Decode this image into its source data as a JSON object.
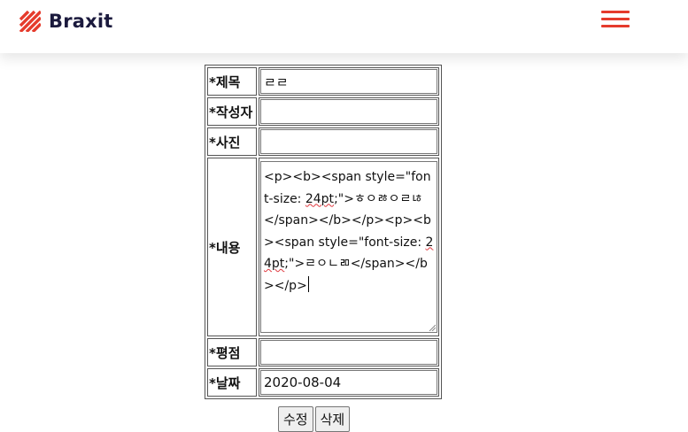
{
  "header": {
    "brand": "Braxit",
    "accent_color": "#e53b2c",
    "brand_color": "#1b1a3d",
    "icon": "hamburger-menu-icon"
  },
  "form": {
    "labels": {
      "title": "*제목",
      "author": "*작성자",
      "photo": "*사진",
      "content": "*내용",
      "rating": "*평점",
      "date": "*날짜"
    },
    "values": {
      "title": "ㄹㄹ",
      "author": "",
      "photo": "",
      "content": {
        "seg1": "<p><b><span style=\"font-size: ",
        "seg2": "24pt",
        "seg3": ";\">ㅎㅇㅀㅇㄹㄶ</span></b></p><p><b><span style=\"font-size: ",
        "seg4": "24pt",
        "seg5": ";\">ㄹㅇㄴㄻ</span></b></p>"
      },
      "rating": "",
      "date": "2020-08-04"
    }
  },
  "actions": {
    "edit": "수정",
    "delete": "삭제"
  }
}
